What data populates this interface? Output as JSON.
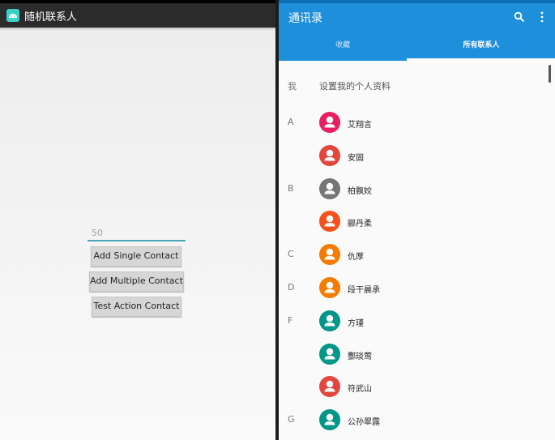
{
  "left_app": {
    "title": "随机联系人",
    "count_value": "50",
    "buttons": {
      "single": "Add Single Contact",
      "multiple": "Add Multiple Contact",
      "action": "Test Action Contact"
    }
  },
  "contacts_app": {
    "title": "通讯录",
    "tabs": {
      "favorites": "收藏",
      "all": "所有联系人"
    },
    "me": {
      "letter": "我",
      "label": "设置我的个人资料"
    },
    "contacts": [
      {
        "letter": "A",
        "name": "艾翔言",
        "color": "#e91e63"
      },
      {
        "letter": "",
        "name": "安固",
        "color": "#e2463c"
      },
      {
        "letter": "B",
        "name": "柏飘姣",
        "color": "#757575"
      },
      {
        "letter": "",
        "name": "郦丹柔",
        "color": "#f4511e"
      },
      {
        "letter": "C",
        "name": "仇厚",
        "color": "#f57c00"
      },
      {
        "letter": "D",
        "name": "段干晨承",
        "color": "#f57c00"
      },
      {
        "letter": "F",
        "name": "方瑾",
        "color": "#009688"
      },
      {
        "letter": "",
        "name": "酆琰莺",
        "color": "#009688"
      },
      {
        "letter": "",
        "name": "符武山",
        "color": "#e2463c"
      },
      {
        "letter": "G",
        "name": "公孙翠露",
        "color": "#009688"
      }
    ]
  }
}
